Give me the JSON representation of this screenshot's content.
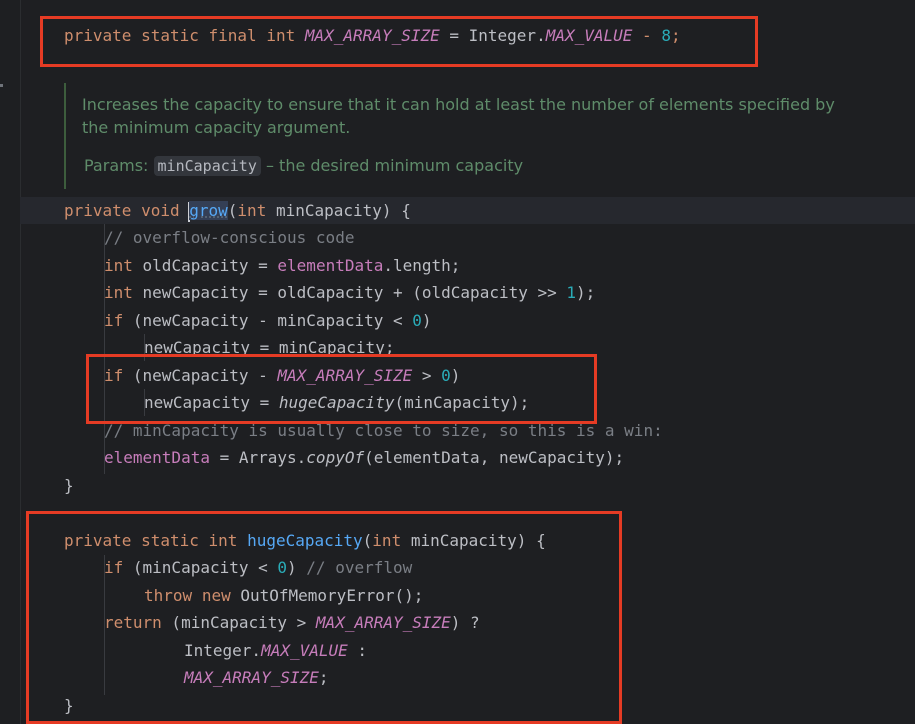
{
  "editor": {
    "code": {
      "max_line": {
        "mod1": "private",
        "mod2": "static",
        "mod3": "final",
        "type": "int",
        "name": "MAX_ARRAY_SIZE",
        "eq": " = Integer.",
        "ref": "MAX_VALUE",
        "minus": " - ",
        "num": "8",
        "semi": ";"
      },
      "doc": {
        "text": "Increases the capacity to ensure that it can hold at least the number of elements specified by the minimum capacity argument.",
        "params_label": "Params:",
        "param_name": "minCapacity",
        "param_desc": "– the desired minimum capacity"
      },
      "grow": {
        "sig_mod": "private",
        "sig_void": "void",
        "sig_name": "grow",
        "sig_args": "(int minCapacity) {",
        "sig_int": "int",
        "sig_rest": " minCapacity) {",
        "l1_comment": "// overflow-conscious code",
        "l2_int": "int",
        "l2_a": " oldCapacity = ",
        "l2_field": "elementData",
        "l2_b": ".length;",
        "l3_int": "int",
        "l3_a": " newCapacity = oldCapacity + (oldCapacity >> ",
        "l3_num": "1",
        "l3_b": ");",
        "l4_if": "if",
        "l4_a": " (newCapacity - minCapacity < ",
        "l4_num": "0",
        "l4_b": ")",
        "l5": "newCapacity = minCapacity;",
        "l6_if": "if",
        "l6_a": " (newCapacity - ",
        "l6_const": "MAX_ARRAY_SIZE",
        "l6_b": " > ",
        "l6_num": "0",
        "l6_c": ")",
        "l7_a": "newCapacity = ",
        "l7_fn": "hugeCapacity",
        "l7_b": "(minCapacity);",
        "l8_comment": "// minCapacity is usually close to size, so this is a win:",
        "l9_field": "elementData",
        "l9_a": " = Arrays.",
        "l9_fn": "copyOf",
        "l9_b": "(elementData, newCapacity);",
        "close": "}"
      },
      "huge": {
        "mod1": "private",
        "mod2": "static",
        "type": "int",
        "name": "hugeCapacity",
        "args_int": "int",
        "args": " minCapacity) {",
        "l1_if": "if",
        "l1_a": " (minCapacity < ",
        "l1_num": "0",
        "l1_b": ") ",
        "l1_comment": "// overflow",
        "l2_throw": "throw",
        "l2_new": "new",
        "l2_a": " OutOfMemoryError();",
        "l3_return": "return",
        "l3_a": " (minCapacity > ",
        "l3_const": "MAX_ARRAY_SIZE",
        "l3_b": ") ?",
        "l4_a": "Integer.",
        "l4_const": "MAX_VALUE",
        "l4_b": " :",
        "l5_const": "MAX_ARRAY_SIZE",
        "l5_b": ";",
        "close": "}"
      }
    },
    "colors": {
      "background": "#1e1f22",
      "keyword": "#cf8e6d",
      "constant": "#c77dbb",
      "number": "#2aacb8",
      "function": "#56a8f5",
      "comment": "#7a7e85",
      "doc_text": "#5f8c6a",
      "annotation_box": "#e53b24"
    }
  }
}
